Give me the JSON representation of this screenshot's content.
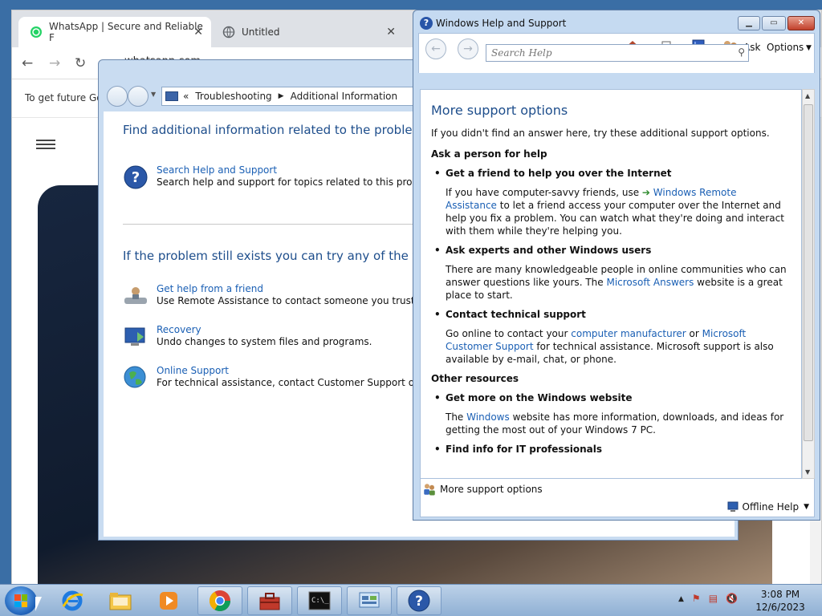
{
  "chrome": {
    "tabs": [
      {
        "label": "WhatsApp | Secure and Reliable F"
      },
      {
        "label": "Untitled"
      }
    ],
    "address": "whatsapp.com",
    "info_bar": "To get future Go"
  },
  "troubleshoot": {
    "breadcrumb": {
      "prefix": "«",
      "part1": "Troubleshooting",
      "part2": "Additional Information"
    },
    "heading1": "Find additional information related to the problem.",
    "item_search": {
      "title": "Search Help and Support",
      "desc": "Search help and support for topics related to this problem."
    },
    "heading2": "If the problem still exists you can try any of the follow",
    "item_friend": {
      "title": "Get help from a friend",
      "desc": "Use Remote Assistance to contact someone you trust for help"
    },
    "item_recovery": {
      "title": "Recovery",
      "desc": "Undo changes to system files and programs."
    },
    "item_online": {
      "title": "Online Support",
      "desc": "For technical assistance, contact Customer Support online."
    }
  },
  "help": {
    "title": "Windows Help and Support",
    "toolbar": {
      "ask": "Ask",
      "options": "Options"
    },
    "search_placeholder": "Search Help",
    "content": {
      "heading": "More support options",
      "intro": "If you didn't find an answer here, try these additional support options.",
      "ask_person": "Ask a person for help",
      "friend_title": "Get a friend to help you over the Internet",
      "friend_p1": "If you have computer-savvy friends, use",
      "friend_link": "Windows Remote Assistance",
      "friend_p2": "to let a friend access your computer over the Internet and help you fix a problem. You can watch what they're doing and interact with them while they're helping you.",
      "experts_title": "Ask experts and other Windows users",
      "experts_p1": "There are many knowledgeable people in online communities who can answer questions like yours. The",
      "experts_link": "Microsoft Answers",
      "experts_p2": "website is a great place to start.",
      "contact_title": "Contact technical support",
      "contact_p1": "Go online to contact your",
      "contact_link1": "computer manufacturer",
      "contact_or": "or",
      "contact_link2": "Microsoft Customer Support",
      "contact_p2": "for technical assistance. Microsoft support is also available by e-mail, chat, or phone.",
      "other": "Other resources",
      "website_title": "Get more on the Windows website",
      "website_p1": "The",
      "website_link": "Windows",
      "website_p2": "website has more information, downloads, and ideas for getting the most out of your Windows 7 PC.",
      "it_title": "Find info for IT professionals"
    },
    "footer_left": "More support options",
    "footer_right": "Offline Help"
  },
  "taskbar": {
    "time": "3:08 PM",
    "date": "12/6/2023"
  }
}
